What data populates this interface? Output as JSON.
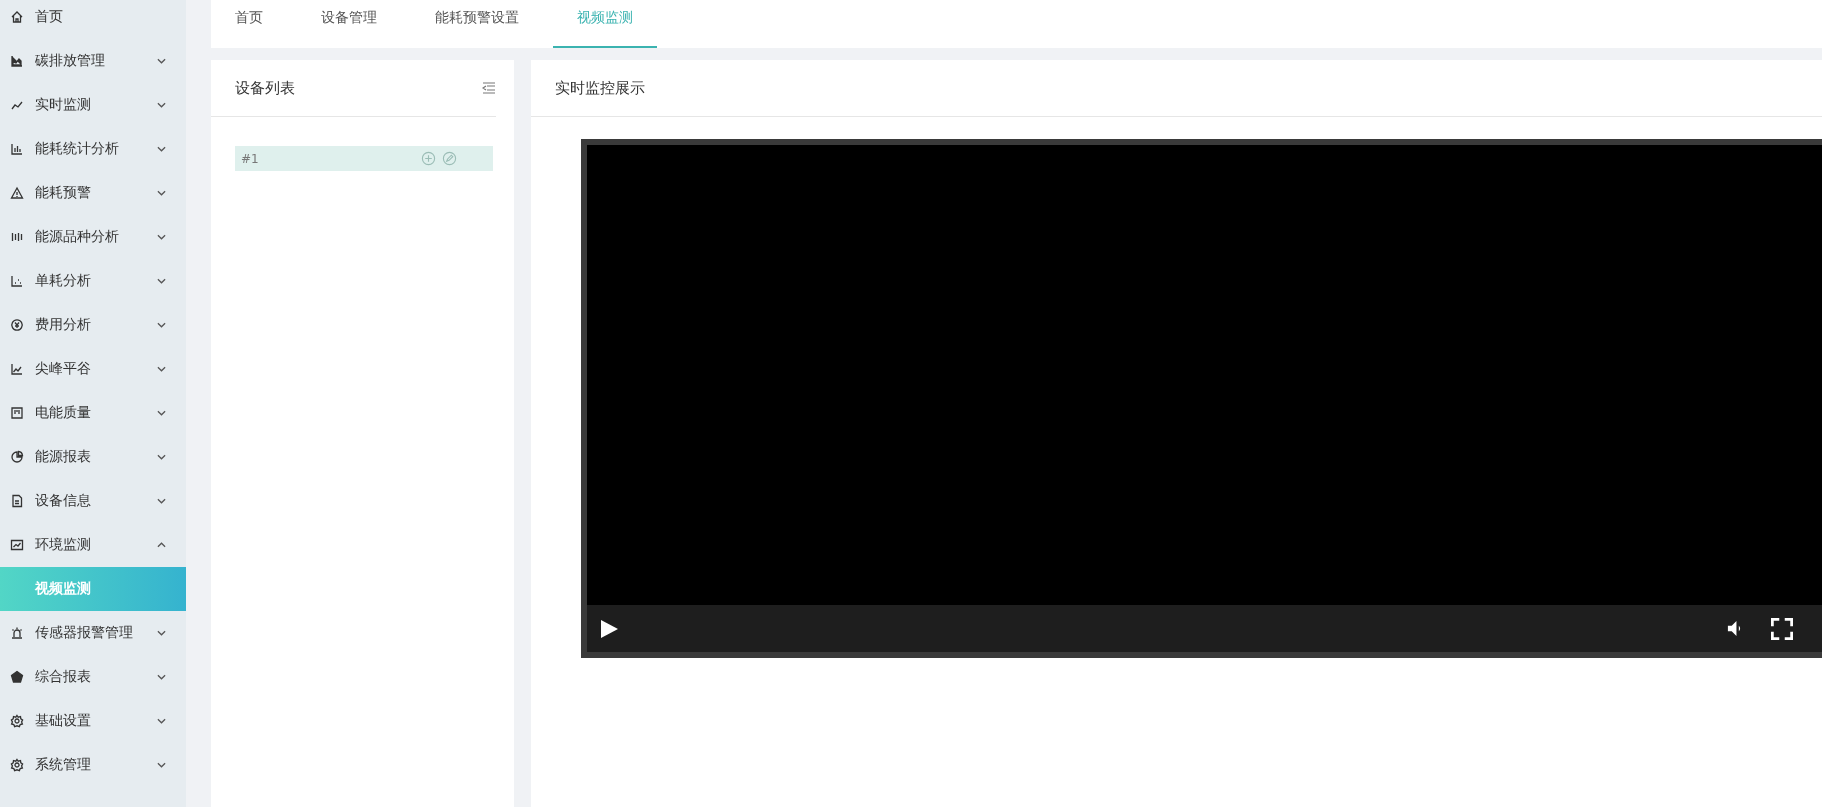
{
  "sidebar": {
    "items": [
      {
        "label": "首页",
        "has_children": false,
        "selected": false
      },
      {
        "label": "碳排放管理",
        "has_children": true,
        "expanded": false,
        "selected": false
      },
      {
        "label": "实时监测",
        "has_children": true,
        "expanded": false,
        "selected": false
      },
      {
        "label": "能耗统计分析",
        "has_children": true,
        "expanded": false,
        "selected": false
      },
      {
        "label": "能耗预警",
        "has_children": true,
        "expanded": false,
        "selected": false
      },
      {
        "label": "能源品种分析",
        "has_children": true,
        "expanded": false,
        "selected": false
      },
      {
        "label": "单耗分析",
        "has_children": true,
        "expanded": false,
        "selected": false
      },
      {
        "label": "费用分析",
        "has_children": true,
        "expanded": false,
        "selected": false
      },
      {
        "label": "尖峰平谷",
        "has_children": true,
        "expanded": false,
        "selected": false
      },
      {
        "label": "电能质量",
        "has_children": true,
        "expanded": false,
        "selected": false
      },
      {
        "label": "能源报表",
        "has_children": true,
        "expanded": false,
        "selected": false
      },
      {
        "label": "设备信息",
        "has_children": true,
        "expanded": false,
        "selected": false
      },
      {
        "label": "环境监测",
        "has_children": true,
        "expanded": true,
        "selected": false,
        "children": [
          {
            "label": "视频监测",
            "selected": true
          }
        ]
      },
      {
        "label": "传感器报警管理",
        "has_children": true,
        "expanded": false,
        "selected": false
      },
      {
        "label": "综合报表",
        "has_children": true,
        "expanded": false,
        "selected": false
      },
      {
        "label": "基础设置",
        "has_children": true,
        "expanded": false,
        "selected": false
      },
      {
        "label": "系统管理",
        "has_children": true,
        "expanded": false,
        "selected": false
      }
    ]
  },
  "tabs": [
    {
      "label": "首页",
      "selected": false
    },
    {
      "label": "设备管理",
      "selected": false
    },
    {
      "label": "能耗预警设置",
      "selected": false
    },
    {
      "label": "视频监测",
      "selected": true
    }
  ],
  "device_panel": {
    "title": "设备列表",
    "items": [
      {
        "label": "#1",
        "selected": true
      }
    ]
  },
  "monitor_panel": {
    "title": "实时监控展示"
  }
}
